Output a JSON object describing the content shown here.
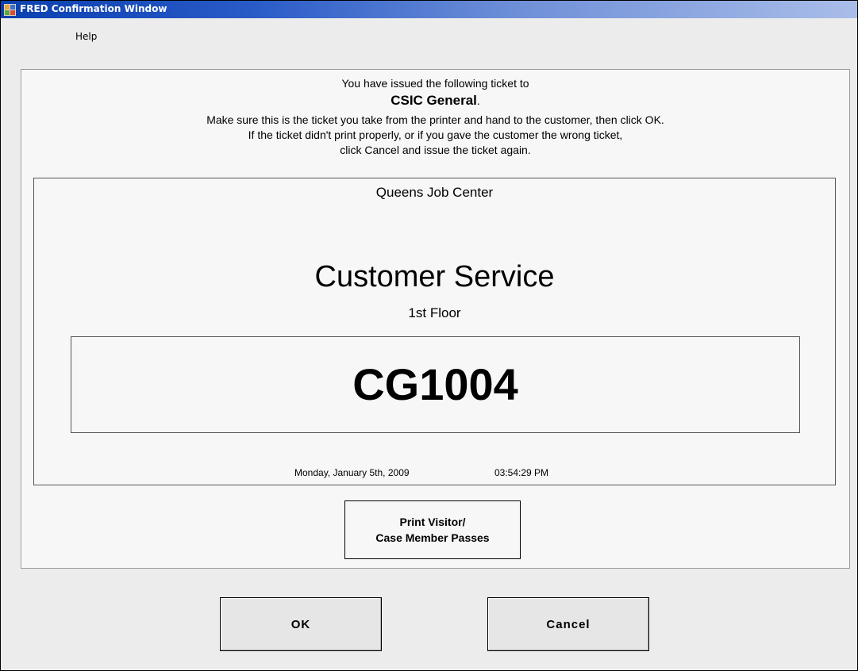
{
  "window": {
    "title": "FRED Confirmation Window"
  },
  "menu": {
    "help_label": "Help"
  },
  "instructions": {
    "line1": "You have issued the following ticket to",
    "recipient": "CSIC General",
    "recipient_suffix": ".",
    "line2": "Make sure this is the ticket you take from the printer and hand to the customer, then click OK.",
    "line3": "If the ticket didn't print properly, or if you gave the customer the wrong ticket,",
    "line4": "click Cancel and issue the ticket again."
  },
  "ticket": {
    "location": "Queens Job Center",
    "service": "Customer Service",
    "floor": "1st Floor",
    "number": "CG1004",
    "date": "Monday, January 5th, 2009",
    "time": "03:54:29 PM"
  },
  "buttons": {
    "print_passes_line1": "Print Visitor/",
    "print_passes_line2": "Case Member Passes",
    "ok_label": "OK",
    "cancel_label": "Cancel"
  },
  "colors": {
    "titlebar_start": "#0a3fb0",
    "titlebar_end": "#a9bde8",
    "window_bg": "#ececec",
    "panel_bg": "#f7f7f7"
  },
  "icons": {
    "app": "app-icon"
  }
}
